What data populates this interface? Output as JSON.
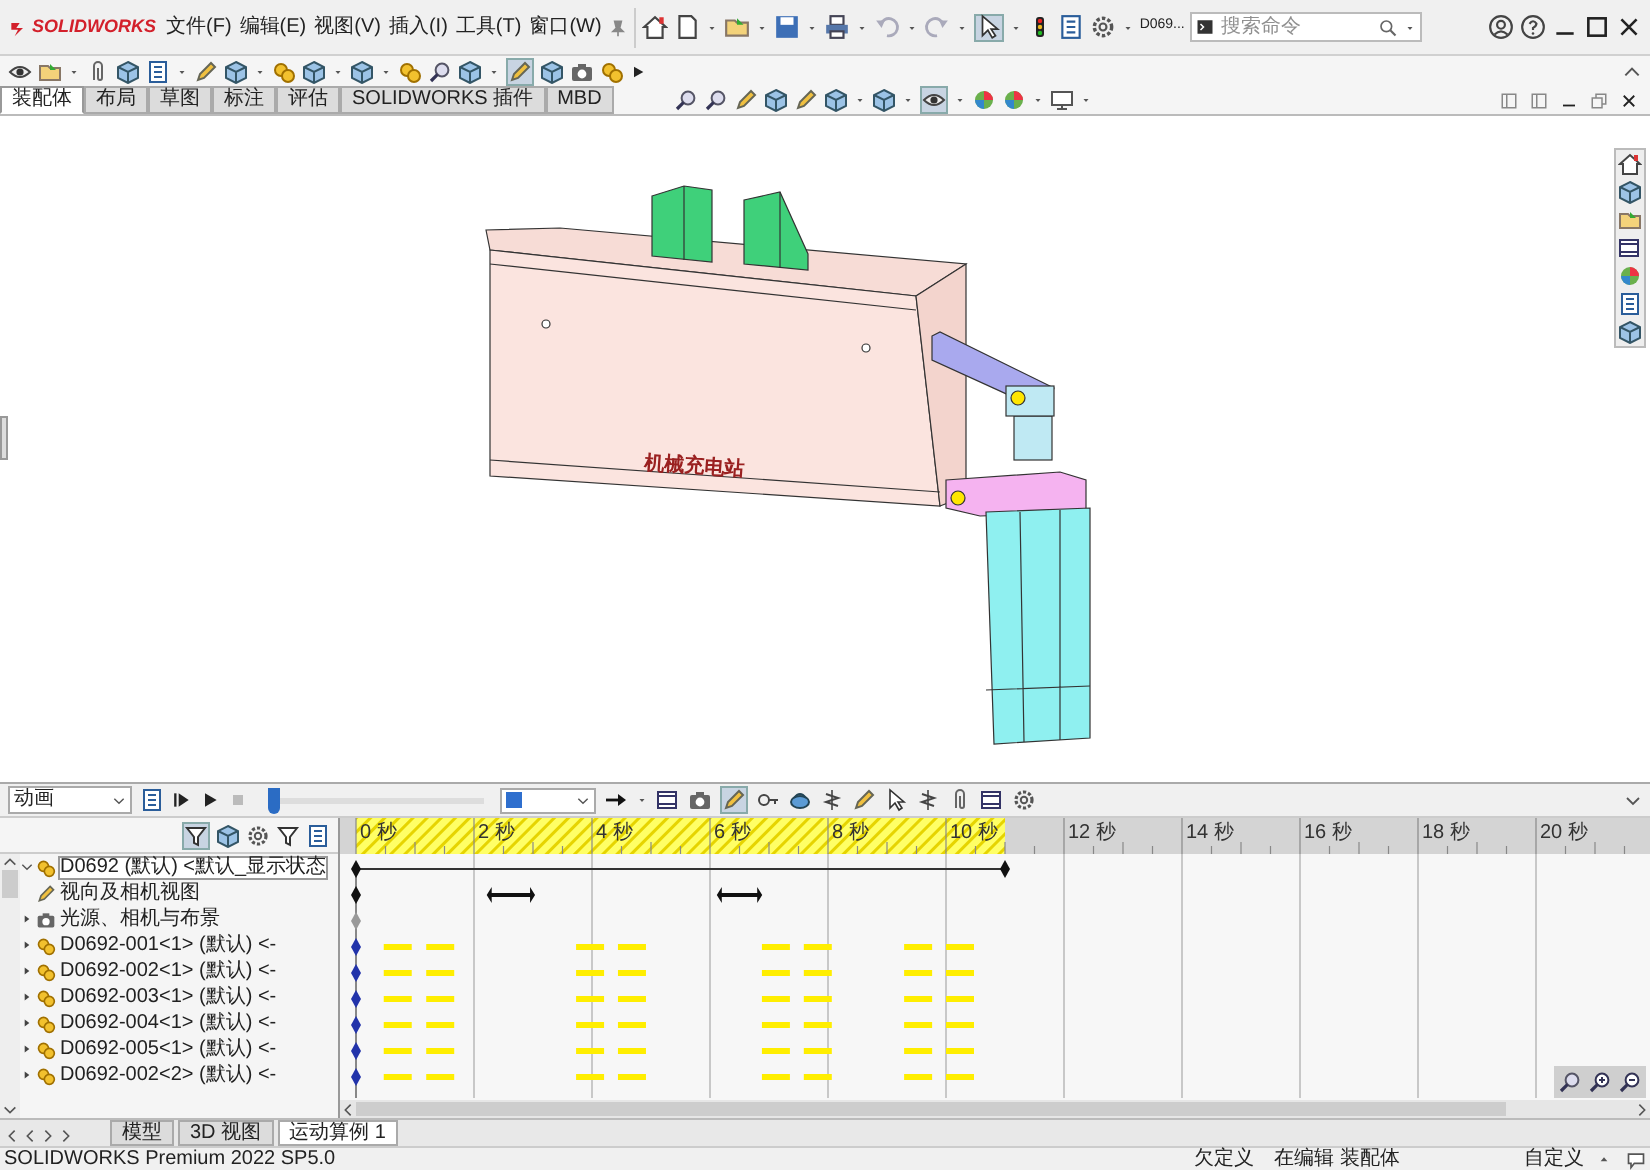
{
  "app": {
    "logo": "SOLIDWORKS",
    "menus": [
      "文件(F)",
      "编辑(E)",
      "视图(V)",
      "插入(I)",
      "工具(T)",
      "窗口(W)"
    ],
    "document": "D069...",
    "search": {
      "placeholder": "搜索命令"
    }
  },
  "tabs": [
    {
      "label": "装配体",
      "selected": true
    },
    {
      "label": "布局",
      "selected": false
    },
    {
      "label": "草图",
      "selected": false
    },
    {
      "label": "标注",
      "selected": false
    },
    {
      "label": "评估",
      "selected": false
    },
    {
      "label": "SOLIDWORKS 插件",
      "selected": false
    },
    {
      "label": "MBD",
      "selected": false
    }
  ],
  "model": {
    "label": "机械充电站"
  },
  "motion": {
    "study_type": "动画",
    "time_slider": {
      "level": 0
    },
    "ruler": [
      "0 秒",
      "2 秒",
      "4 秒",
      "6 秒",
      "8 秒",
      "10 秒",
      "12 秒",
      "14 秒",
      "16 秒",
      "18 秒",
      "20 秒"
    ]
  },
  "tree": [
    {
      "label": "D0692 (默认) <默认_显示状态",
      "kind": "assembly",
      "expanded": true,
      "selected": true
    },
    {
      "label": "视向及相机视图",
      "kind": "camera",
      "selected": false
    },
    {
      "label": "光源、相机与布景",
      "kind": "lights",
      "expanded": false,
      "selected": false
    },
    {
      "label": "D0692-001<1> (默认) <-",
      "kind": "part",
      "expanded": false,
      "selected": false
    },
    {
      "label": "D0692-002<1> (默认) <-",
      "kind": "part",
      "expanded": false,
      "selected": false
    },
    {
      "label": "D0692-003<1> (默认) <-",
      "kind": "part",
      "expanded": false,
      "selected": false
    },
    {
      "label": "D0692-004<1> (默认) <-",
      "kind": "part",
      "expanded": false,
      "selected": false
    },
    {
      "label": "D0692-005<1> (默认) <-",
      "kind": "part",
      "expanded": false,
      "selected": false
    },
    {
      "label": "D0692-002<2> (默认) <-",
      "kind": "part",
      "expanded": false,
      "selected": false
    }
  ],
  "bottom_tabs": [
    {
      "label": "模型",
      "selected": false
    },
    {
      "label": "3D 视图",
      "selected": false
    },
    {
      "label": "运动算例 1",
      "selected": true
    }
  ],
  "status_bar": {
    "product": "SOLIDWORKS Premium 2022 SP5.0",
    "items": [
      "欠定义",
      "在编辑 装配体",
      "自定义"
    ]
  }
}
